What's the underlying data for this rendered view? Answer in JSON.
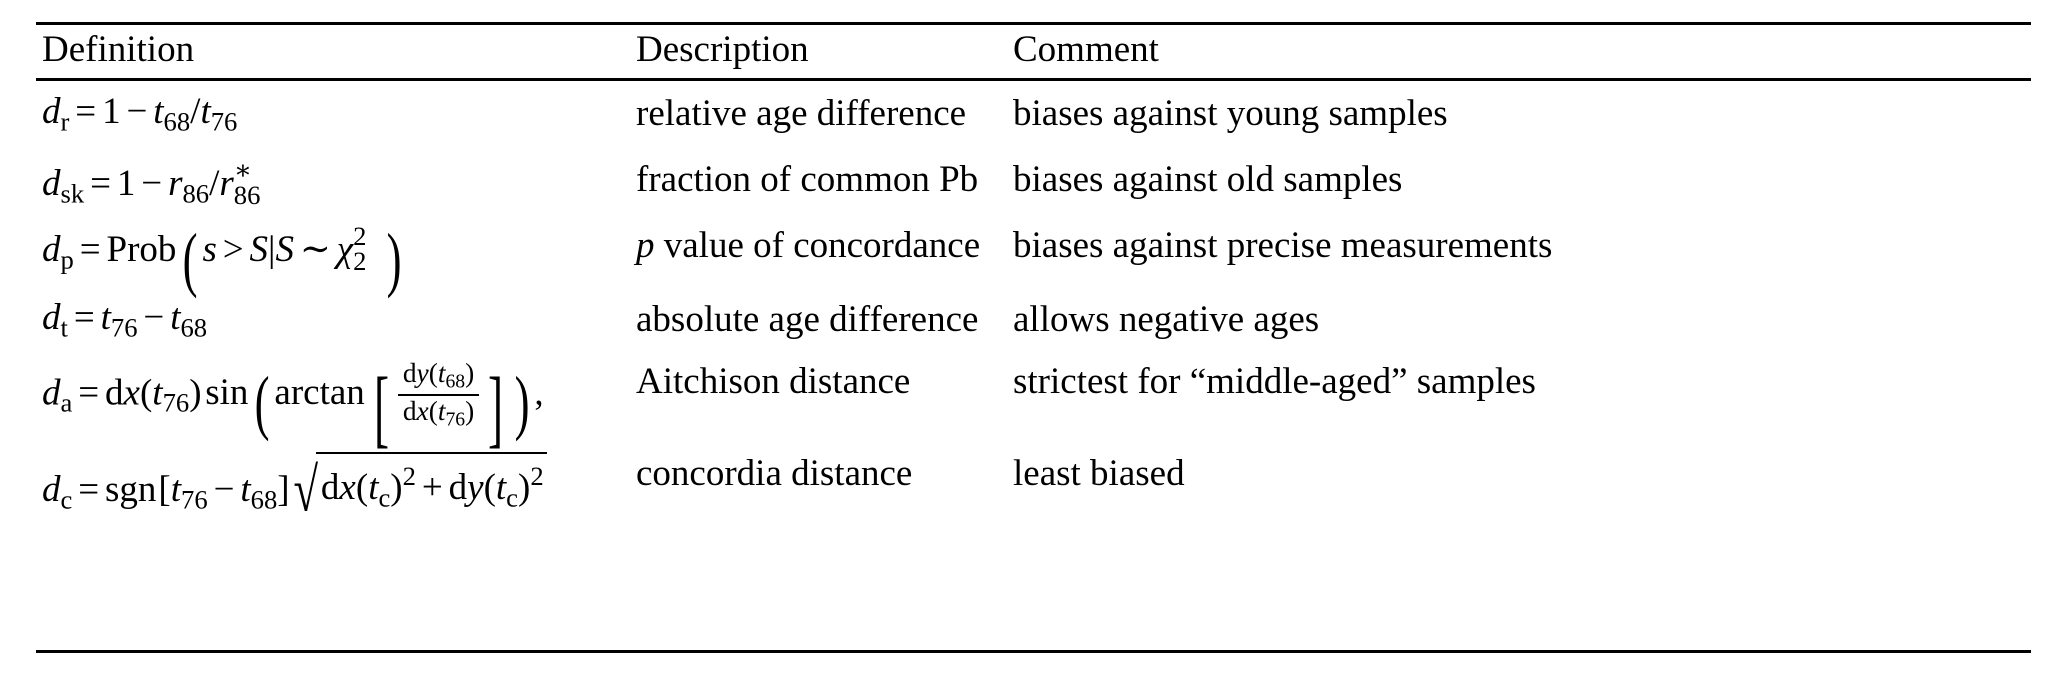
{
  "table": {
    "columns": [
      {
        "key": "definition",
        "label": "Definition"
      },
      {
        "key": "description",
        "label": "Description"
      },
      {
        "key": "comment",
        "label": "Comment"
      }
    ],
    "rows": [
      {
        "definition_text": "d_r = 1 − t_68/t_76",
        "symbol": "d",
        "symbol_sub": "r",
        "description": "relative age difference",
        "comment": "biases against young samples"
      },
      {
        "definition_text": "d_sk = 1 − r_86/r*_86",
        "symbol": "d",
        "symbol_sub": "sk",
        "description": "fraction of common Pb",
        "comment": "biases against old samples"
      },
      {
        "definition_text": "d_p = Prob(s > S|S ~ χ²_2)",
        "symbol": "d",
        "symbol_sub": "p",
        "description_prefix": "p",
        "description_rest": " value of concordance",
        "description": "p value of concordance",
        "comment": "biases against precise measurements"
      },
      {
        "definition_text": "d_t = t_76 − t_68",
        "symbol": "d",
        "symbol_sub": "t",
        "description": "absolute age difference",
        "comment": "allows negative ages"
      },
      {
        "definition_text": "d_a = dx(t_76) sin(arctan[dy(t_68)/dx(t_76)]),",
        "symbol": "d",
        "symbol_sub": "a",
        "description": "Aitchison distance",
        "comment": "strictest for “middle-aged” samples"
      },
      {
        "definition_text": "d_c = sgn[t_76 − t_68]√(dx(t_c)² + dy(t_c)²)",
        "symbol": "d",
        "symbol_sub": "c",
        "description": "concordia distance",
        "comment": "least biased"
      }
    ],
    "math_tokens": {
      "d": "d",
      "t": "t",
      "r": "r",
      "s_lower": "s",
      "S_upper": "S",
      "x": "x",
      "y": "y",
      "one": "1",
      "two": "2",
      "sub_r": "r",
      "sub_sk": "sk",
      "sub_p": "p",
      "sub_t": "t",
      "sub_a": "a",
      "sub_c": "c",
      "sub_68": "68",
      "sub_76": "76",
      "sub_86": "86",
      "sub_2": "2",
      "sup_2": "2",
      "sup_star": "∗",
      "eq": "=",
      "minus": "−",
      "plus": "+",
      "slash": "/",
      "gt": ">",
      "mid": "|",
      "tilde": "∼",
      "comma": ",",
      "chi": "χ",
      "prob": "Prob",
      "sin": "sin",
      "arctan": "arctan",
      "sgn": "sgn",
      "dop": "d",
      "lparen": "(",
      "rparen": ")",
      "lbrack": "[",
      "rbrack": "]",
      "radical": "√"
    }
  },
  "colors": {
    "rule": "#000000",
    "text": "#000000",
    "background": "#ffffff"
  }
}
